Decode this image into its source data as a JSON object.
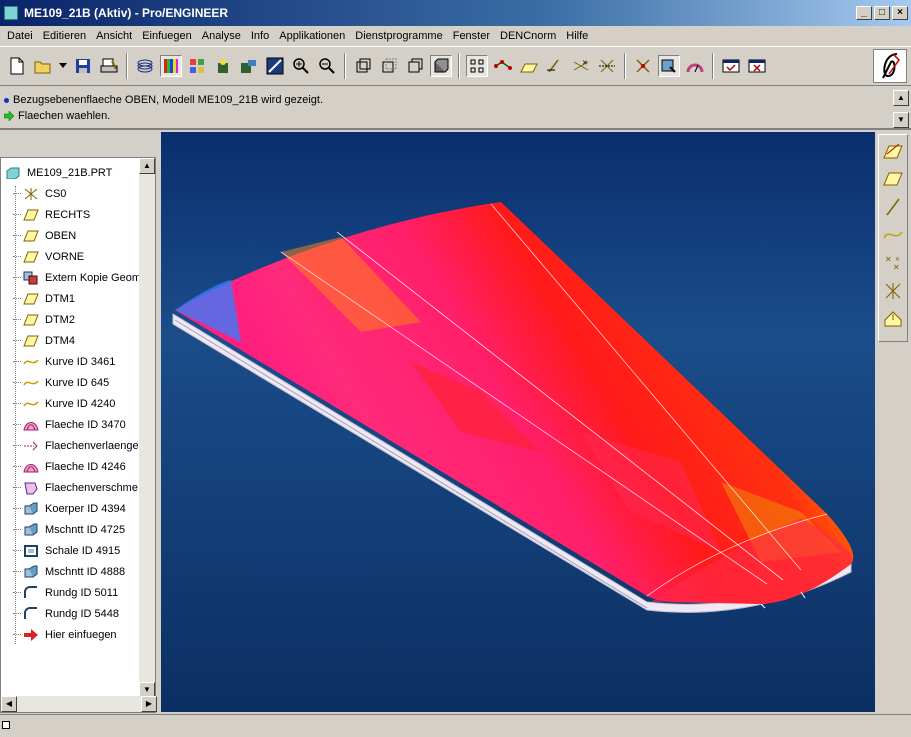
{
  "window": {
    "title": "ME109_21B (Aktiv) - Pro/ENGINEER",
    "minimize": "_",
    "maximize": "□",
    "close": "×"
  },
  "menu": [
    {
      "label": "Datei"
    },
    {
      "label": "Editieren"
    },
    {
      "label": "Ansicht"
    },
    {
      "label": "Einfuegen"
    },
    {
      "label": "Analyse"
    },
    {
      "label": "Info"
    },
    {
      "label": "Applikationen"
    },
    {
      "label": "Dienstprogramme"
    },
    {
      "label": "Fenster"
    },
    {
      "label": "DENCnorm"
    },
    {
      "label": "Hilfe"
    }
  ],
  "messages": {
    "line1": "Bezugsebenenflaeche OBEN, Modell ME109_21B wird gezeigt.",
    "line2": "Flaechen waehlen."
  },
  "tree": {
    "root": "ME109_21B.PRT",
    "items": [
      {
        "label": "CS0",
        "icon": "coordinate-system-icon"
      },
      {
        "label": "RECHTS",
        "icon": "datum-plane-icon"
      },
      {
        "label": "OBEN",
        "icon": "datum-plane-icon"
      },
      {
        "label": "VORNE",
        "icon": "datum-plane-icon"
      },
      {
        "label": "Extern Kopie Geom",
        "icon": "copy-geom-icon"
      },
      {
        "label": "DTM1",
        "icon": "datum-plane-icon"
      },
      {
        "label": "DTM2",
        "icon": "datum-plane-icon"
      },
      {
        "label": "DTM4",
        "icon": "datum-plane-icon"
      },
      {
        "label": "Kurve ID 3461",
        "icon": "curve-icon"
      },
      {
        "label": "Kurve ID 645",
        "icon": "curve-icon"
      },
      {
        "label": "Kurve ID 4240",
        "icon": "curve-icon"
      },
      {
        "label": "Flaeche ID 3470",
        "icon": "surface-icon"
      },
      {
        "label": "Flaechenverlaenge",
        "icon": "surface-extend-icon"
      },
      {
        "label": "Flaeche ID 4246",
        "icon": "surface-icon"
      },
      {
        "label": "Flaechenverschme",
        "icon": "surface-merge-icon"
      },
      {
        "label": "Koerper ID 4394",
        "icon": "solid-icon"
      },
      {
        "label": "Mschntt ID 4725",
        "icon": "solid-icon"
      },
      {
        "label": "Schale ID 4915",
        "icon": "shell-icon"
      },
      {
        "label": "Mschntt ID 4888",
        "icon": "solid-icon"
      },
      {
        "label": "Rundg ID 5011",
        "icon": "round-icon"
      },
      {
        "label": "Rundg ID 5448",
        "icon": "round-icon"
      },
      {
        "label": "Hier einfuegen",
        "icon": "insert-here-arrow-icon"
      }
    ]
  },
  "colors": {
    "viewport_top": "#0a2e6e",
    "viewport_mid": "#1a4d8a",
    "surface_high": "#ff1f7f",
    "surface_mid": "#ff2a1a",
    "surface_low": "#00e8c0"
  }
}
